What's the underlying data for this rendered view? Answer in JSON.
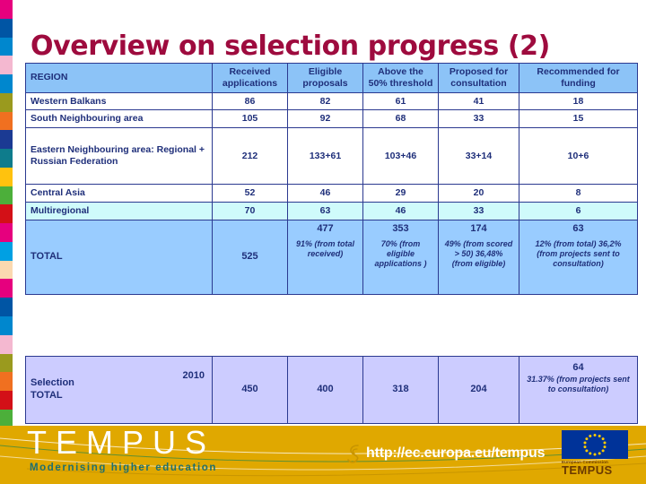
{
  "slide": {
    "title": "Overview on selection progress (2)"
  },
  "table": {
    "headers": [
      "REGION",
      "Received applications",
      "Eligible proposals",
      "Above the 50% threshold",
      "Proposed for consultation",
      "Recommended for funding"
    ],
    "rows": [
      {
        "region": "Western Balkans",
        "received": "86",
        "eligible": "82",
        "above": "61",
        "proposed": "41",
        "recommended": "18"
      },
      {
        "region": "South Neighbouring area",
        "received": "105",
        "eligible": "92",
        "above": "68",
        "proposed": "33",
        "recommended": "15"
      },
      {
        "region": "Eastern Neighbouring area: Regional + Russian Federation",
        "received": "212",
        "eligible": "133+61",
        "above": "103+46",
        "proposed": "33+14",
        "recommended": "10+6"
      },
      {
        "region": "Central Asia",
        "received": "52",
        "eligible": "46",
        "above": "29",
        "proposed": "20",
        "recommended": "8"
      },
      {
        "region": "Multiregional",
        "received": "70",
        "eligible": "63",
        "above": "46",
        "proposed": "33",
        "recommended": "6"
      }
    ],
    "total_row": {
      "label": "TOTAL",
      "received": "525",
      "eligible_value": "477",
      "eligible_pct": "91% (from total received)",
      "above_value": "353",
      "above_pct": "70% (from eligible applications )",
      "proposed_value": "174",
      "proposed_pct": "49% (from scored > 50) 36,48% (from eligible)",
      "recommended_value": "63",
      "recommended_pct": "12% (from total) 36,2% (from projects sent to consultation)"
    }
  },
  "selection_table": {
    "label": "Selection TOTAL",
    "year": "2010",
    "received": "450",
    "eligible": "400",
    "above": "318",
    "proposed": "204",
    "recommended_value": "64",
    "recommended_pct": "31.37% (from projects sent to consultation)"
  },
  "footer": {
    "brand": "TEMPUS",
    "tagline": "Modernising higher education",
    "url": "http://ec.europa.eu/tempus",
    "eu_caption": "European Commission",
    "eu_brand": "TEMPUS"
  },
  "colors": {
    "title": "#9E0B3E",
    "header_bg": "#8CC3F7",
    "total_bg": "#99CCFF",
    "multiregional_bg": "#CFFBFB",
    "selection_bg": "#CCCCFF",
    "border": "#2B3990",
    "text": "#1F2F7A",
    "footer_bg": "#E0A800",
    "tagline": "#1F6F6F",
    "eu_blue": "#003399",
    "eu_star": "#FFCC00"
  },
  "strip_colors": [
    "#E6007E",
    "#0055A4",
    "#0087CE",
    "#F4B8D0",
    "#0087CE",
    "#9A9A1E",
    "#F07020",
    "#1B3A93",
    "#0E7C8C",
    "#FFC20E",
    "#4CAF3A",
    "#D31017",
    "#E6007E",
    "#00A0E3",
    "#FBD9B0",
    "#E6007E",
    "#0055A4",
    "#0087CE",
    "#F4B8D0",
    "#9A9A1E",
    "#F07020",
    "#D31017",
    "#4CAF3A",
    "#0E7C8C",
    "#E6007E",
    "#00A0E3"
  ]
}
